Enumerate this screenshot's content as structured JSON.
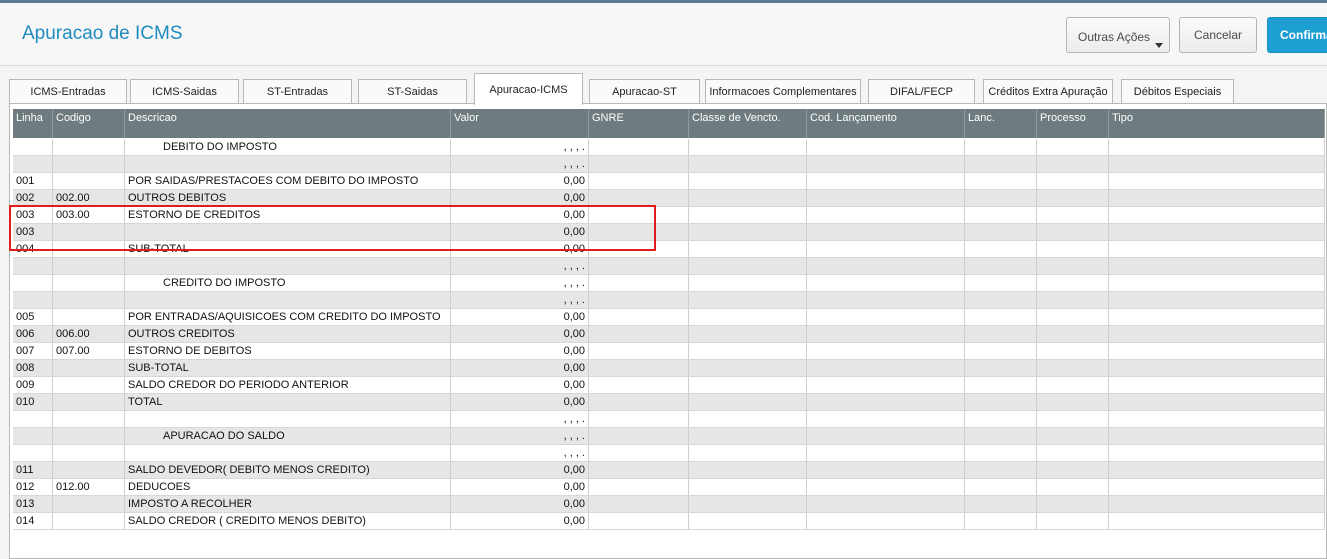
{
  "header": {
    "title": "Apuracao de ICMS",
    "outras_acoes_label": "Outras Ações",
    "cancel_label": "Cancelar",
    "confirm_label": "Confirmar"
  },
  "tabs": [
    {
      "label": "ICMS-Entradas",
      "active": false
    },
    {
      "label": "ICMS-Saidas",
      "active": false
    },
    {
      "label": "ST-Entradas",
      "active": false
    },
    {
      "label": "ST-Saidas",
      "active": false
    },
    {
      "label": "Apuracao-ICMS",
      "active": true
    },
    {
      "label": "Apuracao-ST",
      "active": false
    },
    {
      "label": "Informacoes Complementares",
      "active": false
    },
    {
      "label": "DIFAL/FECP",
      "active": false
    },
    {
      "label": "Créditos Extra Apuração",
      "active": false
    },
    {
      "label": "Débitos Especiais",
      "active": false
    }
  ],
  "columns": [
    "Linha",
    "Codigo",
    "Descricao",
    "Valor",
    "GNRE",
    "Classe de Vencto.",
    "Cod. Lançamento",
    "Lanc.",
    "Processo",
    "Tipo"
  ],
  "rows": [
    {
      "linha": "",
      "codigo": "",
      "descricao": "DEBITO DO IMPOSTO",
      "valor": ", , , .",
      "section": true
    },
    {
      "linha": "",
      "codigo": "",
      "descricao": "",
      "valor": ", , , .",
      "section": false
    },
    {
      "linha": "001",
      "codigo": "",
      "descricao": "POR SAIDAS/PRESTACOES COM DEBITO DO IMPOSTO",
      "valor": "0,00",
      "section": false
    },
    {
      "linha": "002",
      "codigo": "002.00",
      "descricao": "OUTROS DEBITOS",
      "valor": "0,00",
      "section": false
    },
    {
      "linha": "003",
      "codigo": "003.00",
      "descricao": "ESTORNO DE CREDITOS",
      "valor": "0,00",
      "section": false
    },
    {
      "linha": "003",
      "codigo": "",
      "descricao": "",
      "valor": "0,00",
      "section": false
    },
    {
      "linha": "004",
      "codigo": "",
      "descricao": "SUB-TOTAL",
      "valor": "0,00",
      "section": false
    },
    {
      "linha": "",
      "codigo": "",
      "descricao": "",
      "valor": ", , , .",
      "section": false
    },
    {
      "linha": "",
      "codigo": "",
      "descricao": "CREDITO DO IMPOSTO",
      "valor": ", , , .",
      "section": true
    },
    {
      "linha": "",
      "codigo": "",
      "descricao": "",
      "valor": ", , , .",
      "section": false
    },
    {
      "linha": "005",
      "codigo": "",
      "descricao": "POR ENTRADAS/AQUISICOES COM CREDITO DO IMPOSTO",
      "valor": "0,00",
      "section": false
    },
    {
      "linha": "006",
      "codigo": "006.00",
      "descricao": "OUTROS CREDITOS",
      "valor": "0,00",
      "section": false
    },
    {
      "linha": "007",
      "codigo": "007.00",
      "descricao": "ESTORNO DE DEBITOS",
      "valor": "0,00",
      "section": false
    },
    {
      "linha": "008",
      "codigo": "",
      "descricao": "SUB-TOTAL",
      "valor": "0,00",
      "section": false
    },
    {
      "linha": "009",
      "codigo": "",
      "descricao": "SALDO CREDOR DO PERIODO ANTERIOR",
      "valor": "0,00",
      "section": false
    },
    {
      "linha": "010",
      "codigo": "",
      "descricao": "TOTAL",
      "valor": "0,00",
      "section": false
    },
    {
      "linha": "",
      "codigo": "",
      "descricao": "",
      "valor": ", , , .",
      "section": false
    },
    {
      "linha": "",
      "codigo": "",
      "descricao": "APURACAO DO SALDO",
      "valor": ", , , .",
      "section": true
    },
    {
      "linha": "",
      "codigo": "",
      "descricao": "",
      "valor": ", , , .",
      "section": false
    },
    {
      "linha": "011",
      "codigo": "",
      "descricao": "SALDO DEVEDOR( DEBITO MENOS CREDITO)",
      "valor": "0,00",
      "section": false
    },
    {
      "linha": "012",
      "codigo": "012.00",
      "descricao": "DEDUCOES",
      "valor": "0,00",
      "section": false
    },
    {
      "linha": "013",
      "codigo": "",
      "descricao": "IMPOSTO A RECOLHER",
      "valor": "0,00",
      "section": false
    },
    {
      "linha": "014",
      "codigo": "",
      "descricao": "SALDO CREDOR ( CREDITO MENOS DEBITO)",
      "valor": "0,00",
      "section": false
    }
  ],
  "colors": {
    "title": "#1f8bbf",
    "confirm_button": "#1e9fd4",
    "grid_header": "#6e7b7f",
    "highlight_box": "#e01c1c"
  }
}
